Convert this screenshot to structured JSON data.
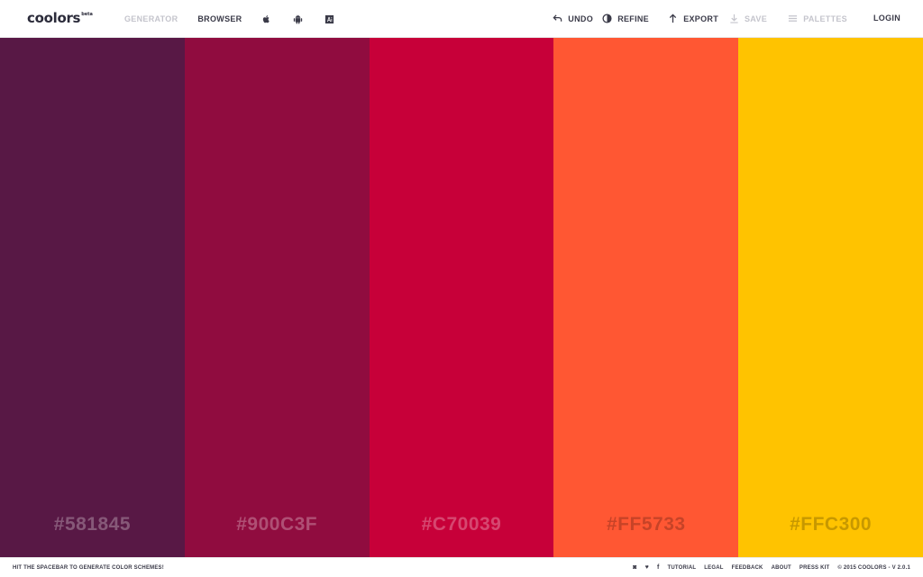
{
  "header": {
    "logo": "coolors",
    "logo_mark": "beta",
    "nav_left": [
      {
        "label": "GENERATOR",
        "muted": true
      },
      {
        "label": "BROWSER",
        "muted": false
      }
    ],
    "platform_icons": [
      "apple-icon",
      "android-icon",
      "adobe-icon"
    ],
    "actions": {
      "undo": "UNDO",
      "refine": "REFINE",
      "export": "EXPORT",
      "save": "SAVE",
      "palettes": "PALETTES",
      "login": "LOGIN"
    }
  },
  "palette": [
    {
      "hex": "#581845",
      "color": "#581845"
    },
    {
      "hex": "#900C3F",
      "color": "#900C3F"
    },
    {
      "hex": "#C70039",
      "color": "#C70039"
    },
    {
      "hex": "#FF5733",
      "color": "#FF5733"
    },
    {
      "hex": "#FFC300",
      "color": "#FFC300"
    }
  ],
  "footer": {
    "hint": "HIT THE SPACEBAR TO GENERATE COLOR SCHEMES!",
    "social": [
      "instagram-icon",
      "twitter-icon",
      "facebook-icon"
    ],
    "social_glyphs": {
      "instagram": "◙",
      "twitter": "♥",
      "facebook": "f"
    },
    "links": [
      "TUTORIAL",
      "LEGAL",
      "FEEDBACK",
      "ABOUT",
      "PRESS KIT"
    ],
    "copyright": "© 2015 COOLORS - V 2.0.1"
  },
  "colors": {
    "text_dark": "#3a3a48",
    "text_muted": "#c4c4cc",
    "background": "#ffffff"
  }
}
